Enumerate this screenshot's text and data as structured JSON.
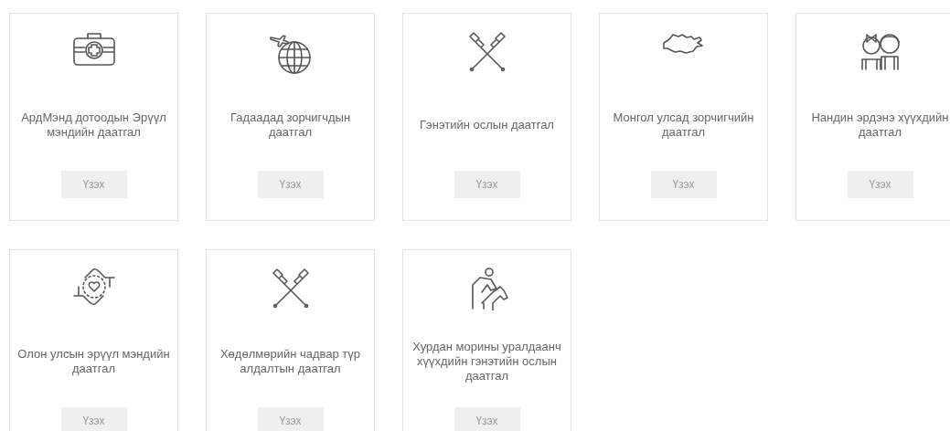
{
  "cards": [
    {
      "kind": "medkit",
      "title": "АрдМэнд дотоодын Эрүүл мэндийн даатгал",
      "button": "Үзэх"
    },
    {
      "kind": "globe",
      "title": "Гадаадад зорчигчдын даатгал",
      "button": "Үзэх"
    },
    {
      "kind": "crutches",
      "title": "Гэнэтийн ослын даатгал",
      "button": "Үзэх"
    },
    {
      "kind": "map",
      "title": "Монгол улсад зорчигчийн даатгал",
      "button": "Үзэх"
    },
    {
      "kind": "children",
      "title": "Нандин эрдэнэ хүүхдийн даатгал",
      "button": "Үзэх"
    },
    {
      "kind": "hands",
      "title": "Олон улсын эрүүл мэндийн даатгал",
      "button": "Үзэх"
    },
    {
      "kind": "crutches",
      "title": "Хөдөлмөрийн чадвар түр алдалтын даатгал",
      "button": "Үзэх"
    },
    {
      "kind": "jockey",
      "title": "Хурдан морины уралдаанч хүүхдийн гэнэтийн ослын даатгал",
      "button": "Үзэх"
    }
  ]
}
